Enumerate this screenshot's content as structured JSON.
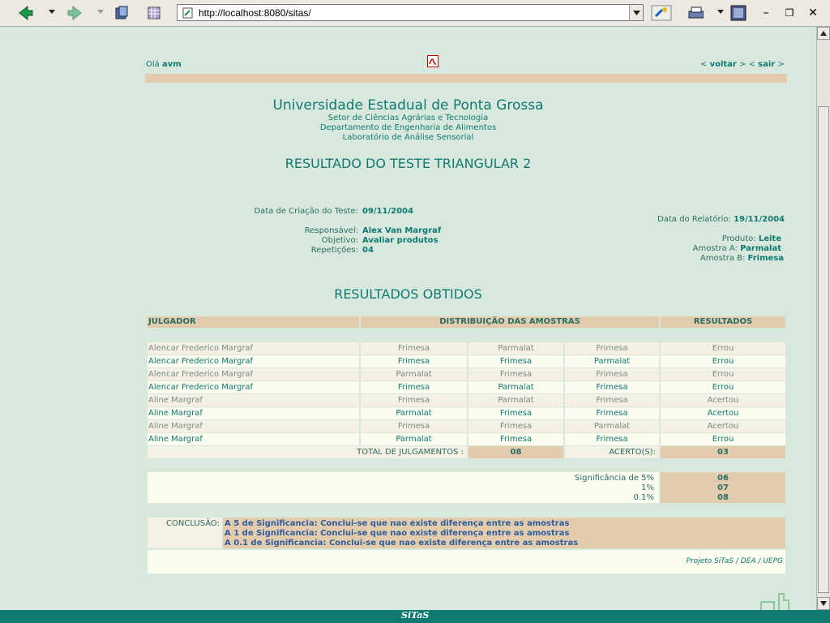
{
  "browser": {
    "url": "http://localhost:8080/sitas/"
  },
  "header": {
    "greeting": "Olá",
    "user": "avm",
    "nav_open1": "< ",
    "voltar": "voltar",
    "nav_mid": " > < ",
    "sair": "sair",
    "nav_close": " >"
  },
  "institution": {
    "name": "Universidade Estadual de Ponta Grossa",
    "sector": "Setor de Ciências Agrárias e Tecnologia",
    "department": "Departamento de Engenharia de Alimentos",
    "lab": "Laboratório de Análise Sensorial"
  },
  "report": {
    "title": "RESULTADO DO TESTE TRIANGULAR 2",
    "created_label": "Data de Criação do Teste:",
    "created_value": "09/11/2004",
    "report_date_label": "Data do Relatório:",
    "report_date_value": "19/11/2004",
    "responsible_label": "Responsável:",
    "responsible_value": "Alex Van Margraf",
    "objective_label": "Objetivo:",
    "objective_value": "Avaliar produtos",
    "repetitions_label": "Repetições:",
    "repetitions_value": "04",
    "product_label": "Produto:",
    "product_value": "Leite",
    "sample_a_label": "Amostra A:",
    "sample_a_value": "Parmalat",
    "sample_b_label": "Amostra B:",
    "sample_b_value": "Frimesa"
  },
  "results": {
    "heading": "RESULTADOS OBTIDOS",
    "col_judge": "JULGADOR",
    "col_distribution": "DISTRIBUIÇÃO DAS AMOSTRAS",
    "col_results": "RESULTADOS",
    "rows": [
      {
        "judge": "Alencar Frederico Margraf",
        "s1": "Frimesa",
        "s2": "Parmalat",
        "s3": "Frimesa",
        "result": "Errou"
      },
      {
        "judge": "Alencar Frederico Margraf",
        "s1": "Frimesa",
        "s2": "Frimesa",
        "s3": "Parmalat",
        "result": "Errou"
      },
      {
        "judge": "Alencar Frederico Margraf",
        "s1": "Parmalat",
        "s2": "Frimesa",
        "s3": "Frimesa",
        "result": "Errou"
      },
      {
        "judge": "Alencar Frederico Margraf",
        "s1": "Frimesa",
        "s2": "Parmalat",
        "s3": "Frimesa",
        "result": "Errou"
      },
      {
        "judge": "Aline Margraf",
        "s1": "Frimesa",
        "s2": "Parmalat",
        "s3": "Frimesa",
        "result": "Acertou"
      },
      {
        "judge": "Aline Margraf",
        "s1": "Parmalat",
        "s2": "Frimesa",
        "s3": "Frimesa",
        "result": "Acertou"
      },
      {
        "judge": "Aline Margraf",
        "s1": "Frimesa",
        "s2": "Frimesa",
        "s3": "Parmalat",
        "result": "Acertou"
      },
      {
        "judge": "Aline Margraf",
        "s1": "Parmalat",
        "s2": "Frimesa",
        "s3": "Frimesa",
        "result": "Errou"
      }
    ],
    "total_label": "TOTAL DE JULGAMENTOS :",
    "total_value": "08",
    "correct_label": "ACERTO(S):",
    "correct_value": "03"
  },
  "significance": {
    "l5": "Significância de 5%",
    "v5": "06",
    "l1": "1%",
    "v1": "07",
    "l01": "0.1%",
    "v01": "08"
  },
  "conclusion": {
    "label": "CONCLUSÃO:",
    "line1": "A 5 de Significancia: Conclui-se que nao existe diferença entre as amostras",
    "line2": "A 1 de Significancia: Conclui-se que nao existe diferença entre as amostras",
    "line3": "A 0.1 de Significancia: Conclui-se que nao existe diferença entre as amostras"
  },
  "footer": {
    "project": "Projeto SiTaS / DEA / UEPG",
    "brand": "SiTaS"
  },
  "colors": {
    "teal": "#0e7a72",
    "beige": "#e3cbad",
    "background": "#d9e8dd"
  }
}
